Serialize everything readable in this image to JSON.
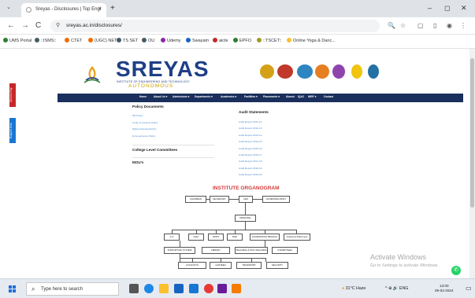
{
  "browser": {
    "tab_title": "Sreyas - Disclosures | Top Engi",
    "tab_close": "×",
    "new_tab": "+",
    "tab_list": "⌄",
    "url": "sreyas.ac.in/disclosures/",
    "window": {
      "minimize": "–",
      "maximize": "◻",
      "close": "✕"
    },
    "nav": {
      "back": "←",
      "forward": "→",
      "reload": "C"
    }
  },
  "bookmarks": [
    {
      "label": "UMS Portal",
      "color": "#2e7d32"
    },
    {
      "label": "::ISMS::",
      "color": "#455a64"
    },
    {
      "label": "CTET",
      "color": "#ef6c00"
    },
    {
      "label": "(UGC) NET",
      "color": "#ef6c00"
    },
    {
      "label": "TS SET",
      "color": "#455a64"
    },
    {
      "label": "OU",
      "color": "#455a64"
    },
    {
      "label": "Udemy",
      "color": "#8e24aa"
    },
    {
      "label": "Swayam",
      "color": "#1565c0"
    },
    {
      "label": "aicte",
      "color": "#c62828"
    },
    {
      "label": "EPFO",
      "color": "#2e7d32"
    },
    {
      "label": "::TSCET::",
      "color": "#9e9d24"
    },
    {
      "label": "Online Yoga & Danc...",
      "color": "#fbc02d"
    }
  ],
  "site": {
    "brand": "SREYAS",
    "brand_sub": "INSTITUTE OF ENGINEERING AND TECHNOLOGY",
    "brand_status": "AUTONOMOUS",
    "side_tabs": [
      "Click to Pay",
      "Enquire Now"
    ],
    "accreditations": [
      {
        "name": "nba",
        "color": "#d4a017"
      },
      {
        "name": "naac",
        "color": "#c0392b"
      },
      {
        "name": "nirf",
        "color": "#2e86c1"
      },
      {
        "name": "aicte",
        "color": "#e67e22"
      },
      {
        "name": "jntuh",
        "color": "#8e44ad"
      },
      {
        "name": "iso",
        "color": "#f1c40f"
      },
      {
        "name": "aaa",
        "color": "#2471a3"
      }
    ],
    "nav": [
      "Home",
      "About Us ▾",
      "Admissions ▾",
      "Departments ▾",
      "Academics ▾",
      "Facilities ▾",
      "Placements ▾",
      "Alumni",
      "IQAC",
      "NIRF ▾",
      "Contact"
    ],
    "policy": {
      "heading": "Policy Documents",
      "links": [
        "HR Policy",
        "Code of Conduct Policy",
        "Waste Disposal Policy",
        "E-Governance Policy"
      ]
    },
    "committees": "College Level Committees",
    "mous": "MOU's",
    "audit": {
      "heading": "Audit Statements",
      "links": [
        "Audit Report 2011-12",
        "Audit Report 2012-13",
        "Audit Report 2013-14",
        "Audit Report 2014-15",
        "Audit Report 2015-16",
        "Audit Report 2016-17",
        "Audit Report 2017-18",
        "Audit Report 2018-19",
        "Audit Report 2019-20"
      ]
    },
    "organogram": {
      "title": "INSTITUTE ORGANOGRAM",
      "boxes": {
        "chairman": "CHAIRMAN",
        "secretary": "SECRETARY",
        "ceo": "CEO",
        "governing_body": "GOVERNING BODY",
        "principal": "PRINCIPAL",
        "ao": "A.O",
        "iqac": "IQAC",
        "hods": "HOD'S",
        "r_d": "R&D",
        "exam_branch": "EXAMINATION BRANCH",
        "training": "Training & Placement",
        "supporting": "SUPPORTING SYSTEM",
        "library": "LIBRARY",
        "teaching": "TEACHING & NON-TEACHING",
        "committees": "COMMITTEES",
        "accounts": "ACCOUNTS",
        "canteen": "CANTEEN",
        "transport": "TRANSPORT",
        "security": "SECURITY"
      }
    },
    "watermark": {
      "title": "Activate Windows",
      "subtitle": "Go to Settings to activate Windows."
    },
    "whatsapp": "✆"
  },
  "taskbar": {
    "search_placeholder": "Type here to search",
    "weather": "31°C  Haze",
    "tray_icons": "^  ⊕  🔊  ENG",
    "time": "13:00",
    "date": "09-02-2024",
    "apps": [
      {
        "name": "task-view",
        "color": "#555"
      },
      {
        "name": "edge",
        "color": "#1e88e5"
      },
      {
        "name": "file-explorer",
        "color": "#fbc02d"
      },
      {
        "name": "store",
        "color": "#1565c0"
      },
      {
        "name": "mail",
        "color": "#1976d2"
      },
      {
        "name": "chrome",
        "color": "#e53935"
      },
      {
        "name": "photos",
        "color": "#6a1b9a"
      },
      {
        "name": "vlc",
        "color": "#f57c00"
      }
    ]
  }
}
